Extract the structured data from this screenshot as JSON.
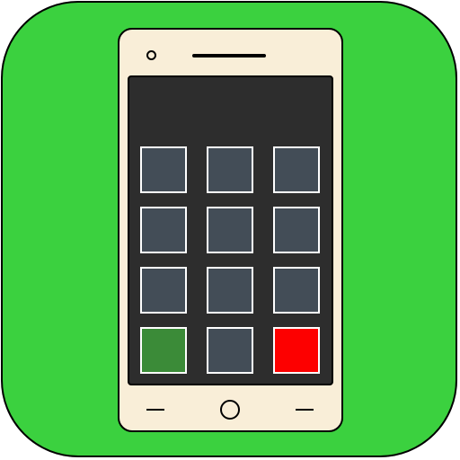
{
  "colors": {
    "tile_background": "#3bd13f",
    "phone_body": "#f9eed8",
    "screen": "#2d2d2d",
    "key_default": "#434d57",
    "key_green": "#3b8b38",
    "key_red": "#fd0000"
  },
  "icons": {
    "camera": "camera-icon",
    "speaker": "speaker-icon",
    "back": "back-nav-icon",
    "home": "home-nav-icon",
    "recent": "recent-apps-nav-icon"
  },
  "keypad": {
    "rows": [
      [
        "default",
        "default",
        "default"
      ],
      [
        "default",
        "default",
        "default"
      ],
      [
        "default",
        "default",
        "default"
      ],
      [
        "green",
        "default",
        "red"
      ]
    ]
  }
}
